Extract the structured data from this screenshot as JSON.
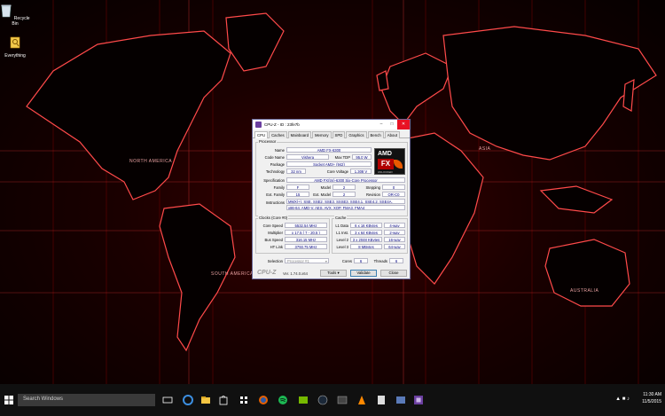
{
  "desktop": {
    "icons": [
      {
        "label": "Recycle Bin"
      },
      {
        "label": "Everything"
      }
    ],
    "map_labels": {
      "north_america": "NORTH AMERICA",
      "asia": "ASIA",
      "south_america": "SOUTH AMERICA",
      "australia": "AUSTRALIA"
    }
  },
  "cpuz": {
    "title": "CPU-Z - ID : 23fe7b",
    "tabs": [
      "CPU",
      "Caches",
      "Mainboard",
      "Memory",
      "SPD",
      "Graphics",
      "Bench",
      "About"
    ],
    "active_tab": "CPU",
    "processor": {
      "group": "Processor",
      "name_label": "Name",
      "name": "AMD FX-6300",
      "codename_label": "Code Name",
      "codename": "Vishera",
      "maxtdp_label": "Max TDP",
      "maxtdp": "95.0 W",
      "package_label": "Package",
      "package": "Socket AM3+ (942)",
      "tech_label": "Technology",
      "tech": "32 nm",
      "voltage_label": "Core Voltage",
      "voltage": "1.308 V",
      "spec_label": "Specification",
      "spec": "AMD FX(tm)-6300 Six-Core Processor",
      "family_label": "Family",
      "family": "F",
      "model_label": "Model",
      "model": "2",
      "stepping_label": "Stepping",
      "stepping": "0",
      "extfamily_label": "Ext. Family",
      "extfamily": "15",
      "extmodel_label": "Ext. Model",
      "extmodel": "2",
      "revision_label": "Revision",
      "revision": "OR-C0",
      "instr_label": "Instructions",
      "instr_line1": "MMX(+), SSE, SSE2, SSE3, SSSE3, SSE4.1, SSE4.2, SSE4A,",
      "instr_line2": "x86-64, AMD-V, AES, AVX, XOP, FMA3, FMA4"
    },
    "logo": {
      "brand": "AMD",
      "product": "FX",
      "tagline": "UNLOCKED"
    },
    "clocks": {
      "group": "Clocks (Core #0)",
      "core_speed_label": "Core Speed",
      "core_speed": "5532.54 MHz",
      "multiplier_label": "Multiplier",
      "multiplier": "x 17.5 ( 7 - 20.5 )",
      "bus_speed_label": "Bus Speed",
      "bus_speed": "316.15 MHz",
      "ht_link_label": "HT Link",
      "ht_link": "3793.75 MHz"
    },
    "cache": {
      "group": "Cache",
      "l1d_label": "L1 Data",
      "l1d": "6 x 16 KBytes",
      "l1d_way": "4-way",
      "l1i_label": "L1 Inst.",
      "l1i": "3 x 64 KBytes",
      "l1i_way": "2-way",
      "l2_label": "Level 2",
      "l2": "3 x 2048 KBytes",
      "l2_way": "16-way",
      "l3_label": "Level 3",
      "l3": "8 MBytes",
      "l3_way": "64-way"
    },
    "selection_label": "Selection",
    "selection": "Processor #1",
    "cores_label": "Cores",
    "cores": "6",
    "threads_label": "Threads",
    "threads": "6",
    "footer_brand": "CPU-Z",
    "version": "Ver. 1.74.0.x64",
    "tools_label": "Tools",
    "validate_label": "Validate",
    "close_label": "Close"
  },
  "taskbar": {
    "search_placeholder": "Search Windows",
    "time": "11:30 AM",
    "date": "11/5/2015",
    "accent": "#7db4ff"
  }
}
